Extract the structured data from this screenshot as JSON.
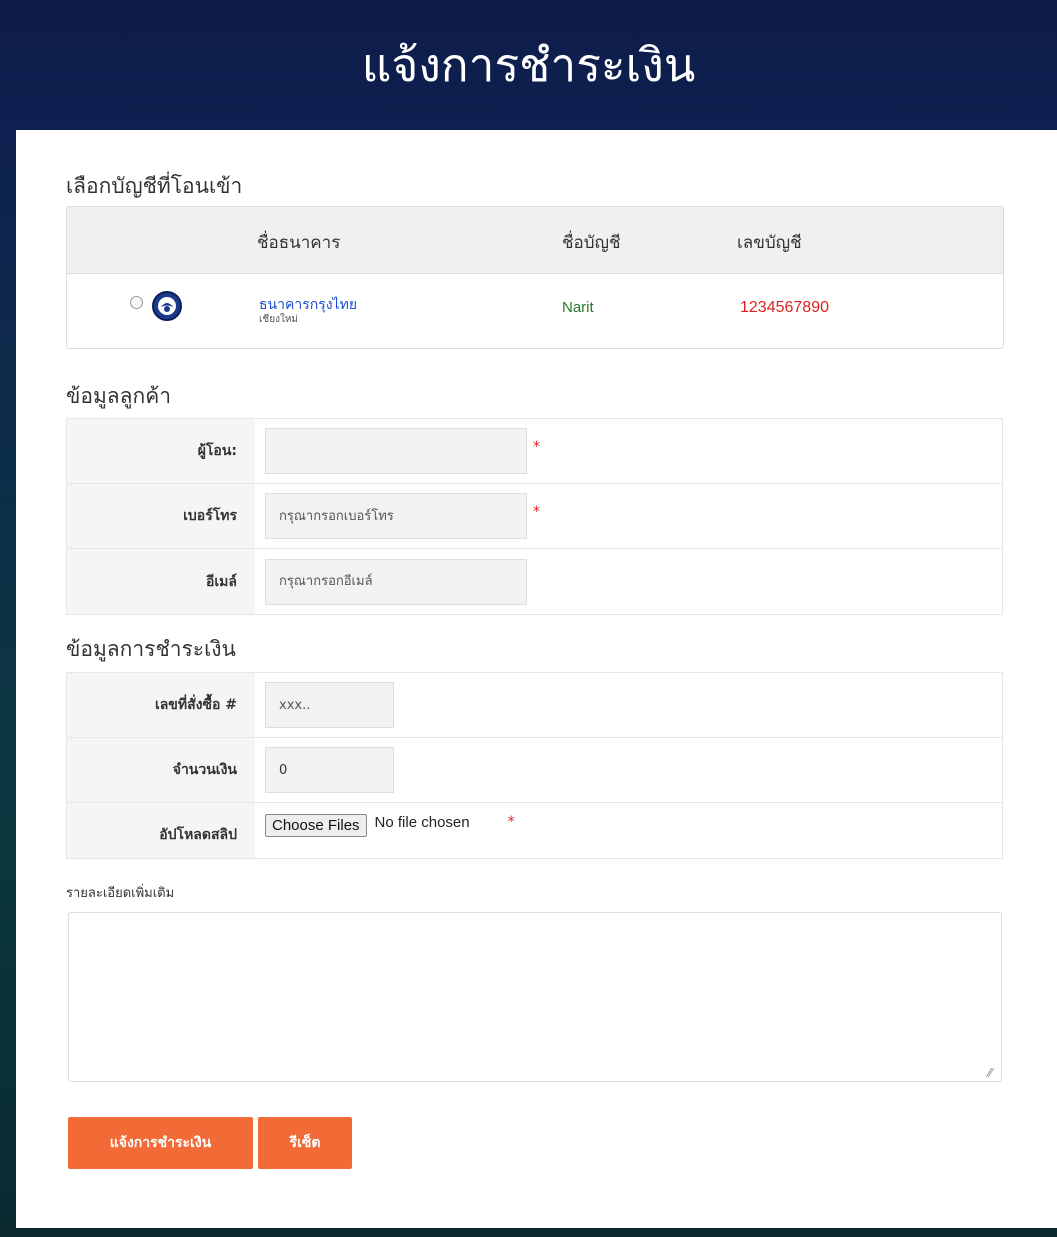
{
  "header": {
    "title": "แจ้งการชำระเงิน"
  },
  "account_section": {
    "title": "เลือกบัญชีที่โอนเข้า",
    "columns": [
      "ชื่อธนาคาร",
      "ชื่อบัญชี",
      "เลขบัญชี"
    ],
    "rows": [
      {
        "bank_name": "ธนาคารกรุงไทย",
        "branch": "เชียงใหม่",
        "account_name": "Narit",
        "account_no": "1234567890",
        "selected": false
      }
    ]
  },
  "customer_section": {
    "title": "ข้อมูลลูกค้า",
    "sender_label": "ผู้โอน:",
    "sender_value": "",
    "phone_label": "เบอร์โทร",
    "phone_placeholder": "กรุณากรอกเบอร์โทร",
    "email_label": "อีเมล์",
    "email_placeholder": "กรุณากรอกอีเมล์",
    "required_mark": "*"
  },
  "payment_section": {
    "title": "ข้อมูลการชำระเงิน",
    "order_label": "เลขที่สั่งซื้อ #",
    "order_placeholder": "xxx..",
    "amount_label": "จำนวนเงิน",
    "amount_value": "0",
    "slip_label": "อัปโหลดสลิป",
    "file_button": "Choose Files",
    "file_status": "No file chosen",
    "required_mark": "*"
  },
  "details": {
    "label": "รายละเอียดเพิ่มเติม",
    "value": ""
  },
  "buttons": {
    "submit": "แจ้งการชำระเงิน",
    "reset": "รีเซ็ต"
  },
  "colors": {
    "header_bg": "#0d1b4a",
    "button": "#f26a35",
    "account_name": "#2a7a2a",
    "account_no": "#e02020",
    "bank_name": "#1a4fd0"
  }
}
